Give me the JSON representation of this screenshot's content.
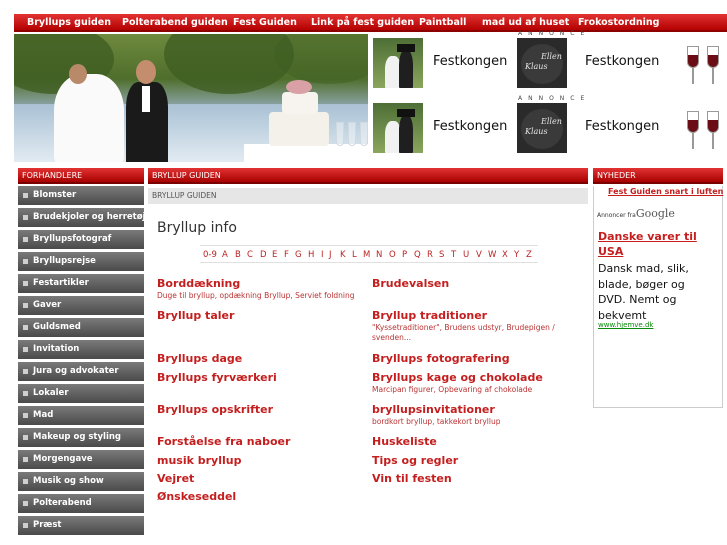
{
  "topnav": [
    "Bryllups guiden",
    "Polterabend guiden",
    "Fest Guiden",
    "Link på fest guiden",
    "Paintball",
    "mad ud af huset",
    "Frokostordning"
  ],
  "ads": {
    "annonce_label": "ANNONCE",
    "row1": {
      "text1": "Festkongen",
      "text2": "Festkongen"
    },
    "row2": {
      "text1": "Festkongen",
      "text2": "Festkongen"
    },
    "chalk": {
      "name1": "Klaus",
      "name2": "Ellen"
    }
  },
  "sidebar": {
    "header": "FORHANDLERE",
    "items": [
      "Blomster",
      "Brudekjoler og herretøj",
      "Bryllupsfotograf",
      "Bryllupsrejse",
      "Festartikler",
      "Gaver",
      "Guldsmed",
      "Invitation",
      "Jura og advokater",
      "Lokaler",
      "Mad",
      "Makeup og styling",
      "Morgengave",
      "Musik og show",
      "Polterabend",
      "Præst"
    ]
  },
  "main": {
    "header": "BRYLLUP GUIDEN",
    "subheader": "BRYLLUP GUIDEN",
    "title": "Bryllup info",
    "alphabet": [
      "0-9",
      "A",
      "B",
      "C",
      "D",
      "E",
      "F",
      "G",
      "H",
      "I",
      "J",
      "K",
      "L",
      "M",
      "N",
      "O",
      "P",
      "Q",
      "R",
      "S",
      "T",
      "U",
      "V",
      "W",
      "X",
      "Y",
      "Z"
    ],
    "categories_left": [
      {
        "title": "Borddækning",
        "sub": "Duge til bryllup, opdækning Bryllup, Serviet foldning"
      },
      {
        "title": "Bryllup taler",
        "sub": ""
      },
      {
        "title": "Bryllups dage",
        "sub": ""
      },
      {
        "title": "Bryllups fyrværkeri",
        "sub": ""
      },
      {
        "title": "Bryllups opskrifter",
        "sub": ""
      },
      {
        "title": "Forståelse fra naboer",
        "sub": ""
      },
      {
        "title": "musik bryllup",
        "sub": ""
      },
      {
        "title": "Vejret",
        "sub": ""
      },
      {
        "title": "Ønskeseddel",
        "sub": ""
      }
    ],
    "categories_right": [
      {
        "title": "Brudevalsen",
        "sub": ""
      },
      {
        "title": "Bryllup traditioner",
        "sub": "\"Kyssetraditioner\", Brudens udstyr, Brudepigen / svenden..."
      },
      {
        "title": "Bryllups fotografering",
        "sub": ""
      },
      {
        "title": "Bryllups kage og chokolade",
        "sub": "Marcipan figurer, Opbevaring af chokolade"
      },
      {
        "title": "bryllupsinvitationer",
        "sub": "bordkort bryllup, takkekort bryllup"
      },
      {
        "title": "Huskeliste",
        "sub": ""
      },
      {
        "title": "Tips og regler",
        "sub": ""
      },
      {
        "title": "Vin til festen",
        "sub": ""
      }
    ]
  },
  "news": {
    "header": "NYHEDER",
    "link": "Fest Guiden snart i luften",
    "google_prefix": "Annoncer fra",
    "google_brand": "Google",
    "ad_title": "Danske varer til USA",
    "ad_body": "Dansk mad, slik, blade, bøger og DVD. Nemt og bekvemt",
    "ad_url": "www.hjemve.dk"
  },
  "colors": {
    "accent": "#c41e1e",
    "nav_bg": "#cc0000",
    "sidebar_item": "#5a5a5a"
  }
}
